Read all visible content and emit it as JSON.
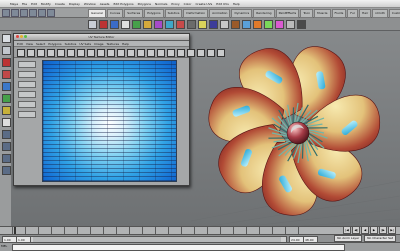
{
  "menubar": {
    "apple": "",
    "items": [
      "Maya",
      "File",
      "Edit",
      "Modify",
      "Create",
      "Display",
      "Window",
      "Assets",
      "Edit Polygons",
      "Polygons",
      "Normals",
      "Proxy",
      "Color",
      "Create UVs",
      "Edit UVs",
      "Help"
    ],
    "clock": ""
  },
  "shelf": {
    "tabs": [
      {
        "label": "General",
        "active": true
      },
      {
        "label": "Curves"
      },
      {
        "label": "Surfaces"
      },
      {
        "label": "Polygons"
      },
      {
        "label": "Subdivs"
      },
      {
        "label": "Deformation"
      },
      {
        "label": "Animation"
      },
      {
        "label": "Dynamics"
      },
      {
        "label": "Rendering"
      },
      {
        "label": "PaintEffects"
      },
      {
        "label": "Toon"
      },
      {
        "label": "Muscle"
      },
      {
        "label": "Fluids"
      },
      {
        "label": "Fur"
      },
      {
        "label": "Hair"
      },
      {
        "label": "nCloth"
      },
      {
        "label": "Custom"
      }
    ],
    "icon_colors": [
      "#c9ced6",
      "#b33",
      "#3a6bc7",
      "#e0e0e0",
      "#46a04a",
      "#d6a93b",
      "#a64ac9",
      "#3fa7c7",
      "#c74a4a",
      "#6b6b6b",
      "#d9d35a",
      "#3c3c9a",
      "#c8c8c8",
      "#9a5a2a",
      "#5aa0d9",
      "#e07a2a",
      "#7ad95a",
      "#d95ad0",
      "#bbbbbb",
      "#4a4a4a"
    ]
  },
  "editor": {
    "title": "UV Texture Editor",
    "menus": [
      "Edit",
      "View",
      "Select",
      "Polygons",
      "Subdivs",
      "UV Sets",
      "Image",
      "Textures",
      "Help"
    ]
  },
  "timeline": {
    "start": "1.00",
    "end": "24.00",
    "range_end": "48.00",
    "current": "1.00",
    "anim_layer": "No Anim Layer",
    "char_set": "No Character Set"
  },
  "playback": [
    "|◀",
    "◀|",
    "◀",
    "▶",
    "|▶",
    "▶|"
  ],
  "status": {
    "mel_label": "MEL",
    "message": ""
  },
  "colors": {
    "accent": "#1e78d8",
    "viewport_bg": "#7d7f80",
    "petal_yellow": "#e8d487",
    "petal_red": "#a0262a",
    "cyan_part": "#3ec6e8"
  }
}
